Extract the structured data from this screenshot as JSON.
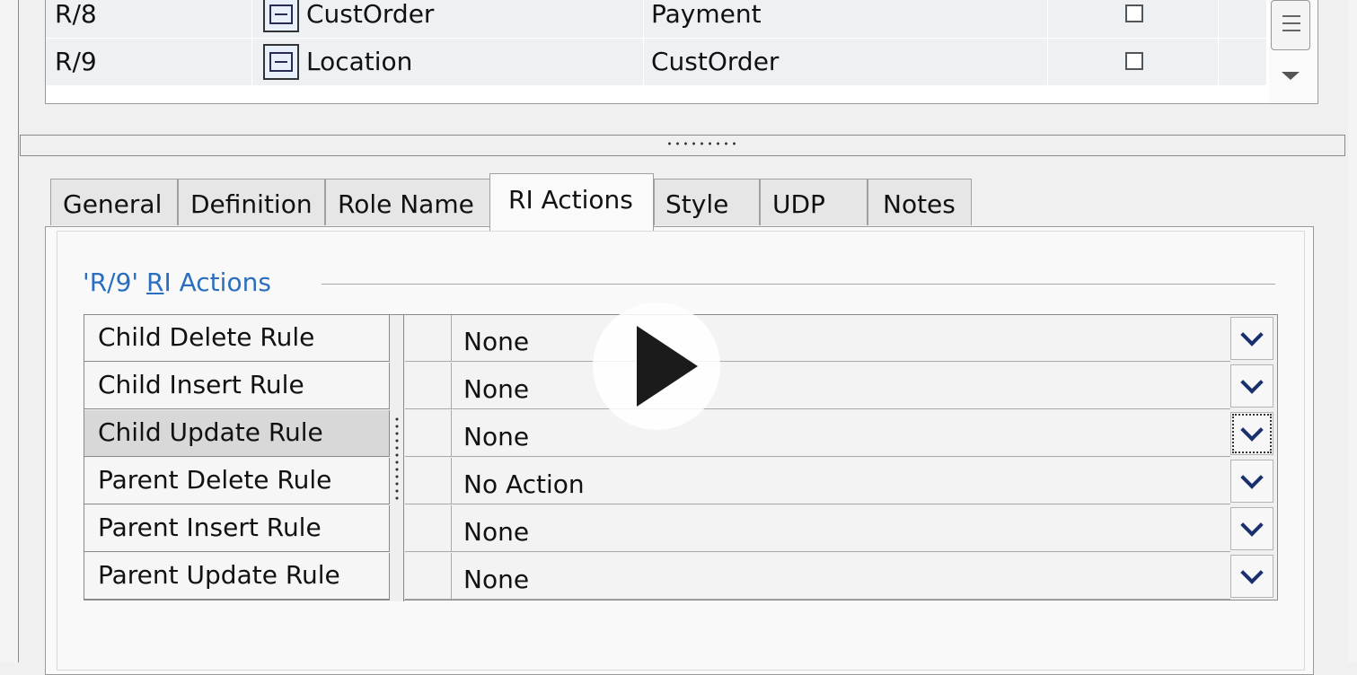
{
  "relationships": [
    {
      "name": "R/8",
      "parent": "CustOrder",
      "child": "Payment"
    },
    {
      "name": "R/9",
      "parent": "Location",
      "child": "CustOrder"
    }
  ],
  "tabs": [
    "General",
    "Definition",
    "Role Name",
    "RI Actions",
    "Style",
    "UDP",
    "Notes"
  ],
  "active_tab": "RI Actions",
  "group": {
    "prefix": "'R/9' ",
    "accel": "R",
    "rest": "I Actions"
  },
  "ri_rules": [
    {
      "label": "Child Delete Rule",
      "value": "None"
    },
    {
      "label": "Child Insert Rule",
      "value": "None"
    },
    {
      "label": "Child Update Rule",
      "value": "None"
    },
    {
      "label": "Parent Delete Rule",
      "value": "No Action"
    },
    {
      "label": "Parent Insert Rule",
      "value": "None"
    },
    {
      "label": "Parent Update Rule",
      "value": "None"
    }
  ],
  "selected_rule": "Child Update Rule",
  "icons": {
    "entity": "entity-icon",
    "play": "play-icon",
    "dropdown": "chevron-down-icon"
  }
}
